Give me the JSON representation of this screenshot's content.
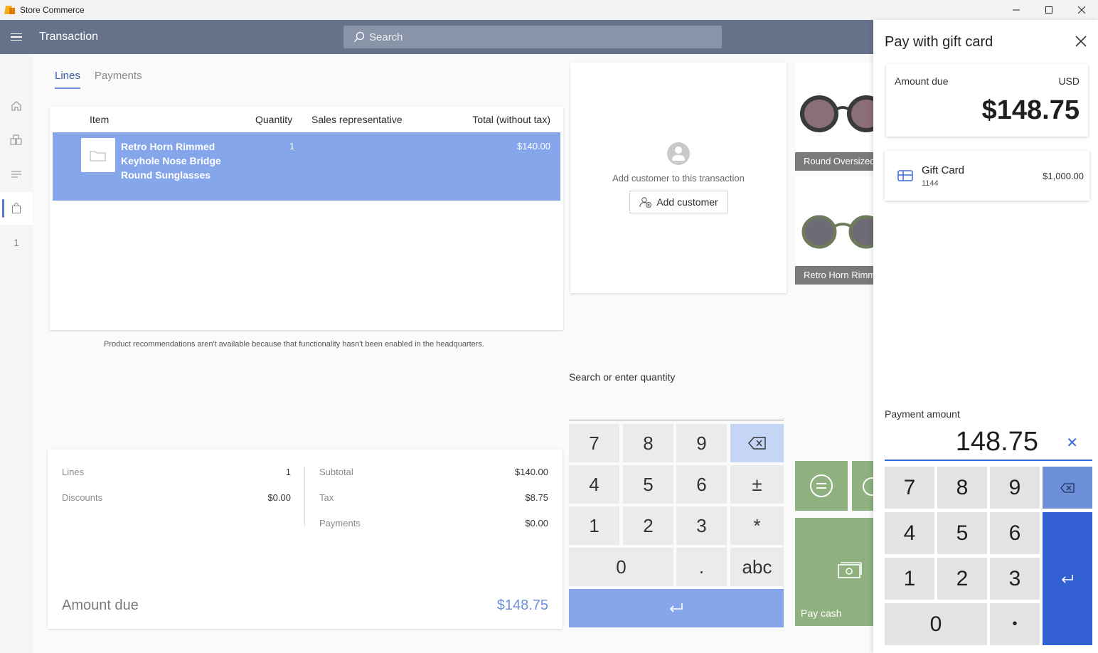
{
  "window": {
    "title": "Store Commerce"
  },
  "header": {
    "page_title": "Transaction",
    "search_placeholder": "Search"
  },
  "rail": {
    "items": [
      "home-icon",
      "products-icon",
      "orders-icon",
      "cart-icon"
    ],
    "badge": "1"
  },
  "tabs": [
    {
      "label": "Lines",
      "active": true
    },
    {
      "label": "Payments",
      "active": false
    }
  ],
  "lines": {
    "columns": [
      "Item",
      "Quantity",
      "Sales representative",
      "Total (without tax)"
    ],
    "rows": [
      {
        "name": "Retro Horn Rimmed Keyhole Nose Bridge Round Sunglasses",
        "quantity": "1",
        "sales_rep": "",
        "total": "$140.00"
      }
    ]
  },
  "recommendation_note": "Product recommendations aren't available because that functionality hasn't been enabled in the headquarters.",
  "customer": {
    "prompt": "Add customer to this transaction",
    "button": "Add customer"
  },
  "product_tiles": [
    {
      "label": "Round Oversized"
    },
    {
      "label": "Retro Horn Rimmed"
    }
  ],
  "quantity_entry": {
    "label": "Search or enter quantity",
    "value": ""
  },
  "numpad_keys": [
    "7",
    "8",
    "9",
    "4",
    "5",
    "6",
    "±",
    "1",
    "2",
    "3",
    "*",
    "0",
    ".",
    "abc"
  ],
  "totals": {
    "lines_label": "Lines",
    "lines_value": "1",
    "discounts_label": "Discounts",
    "discounts_value": "$0.00",
    "subtotal_label": "Subtotal",
    "subtotal_value": "$140.00",
    "tax_label": "Tax",
    "tax_value": "$8.75",
    "payments_label": "Payments",
    "payments_value": "$0.00",
    "amount_due_label": "Amount due",
    "amount_due_value": "$148.75"
  },
  "actions": {
    "pay_cash": "Pay cash"
  },
  "panel": {
    "title": "Pay with gift card",
    "amount_due_label": "Amount due",
    "currency": "USD",
    "amount_due": "$148.75",
    "gift_card": {
      "name": "Gift Card",
      "number": "1144",
      "balance": "$1,000.00"
    },
    "payment_amount_label": "Payment amount",
    "payment_amount": "148.75",
    "keys": [
      "7",
      "8",
      "9",
      "4",
      "5",
      "6",
      "1",
      "2",
      "3",
      "0",
      "•"
    ]
  },
  "colors": {
    "header": "#66728a",
    "selected_row": "#86a6ec",
    "accent": "#3260d2",
    "action_green": "#8fb07f"
  }
}
